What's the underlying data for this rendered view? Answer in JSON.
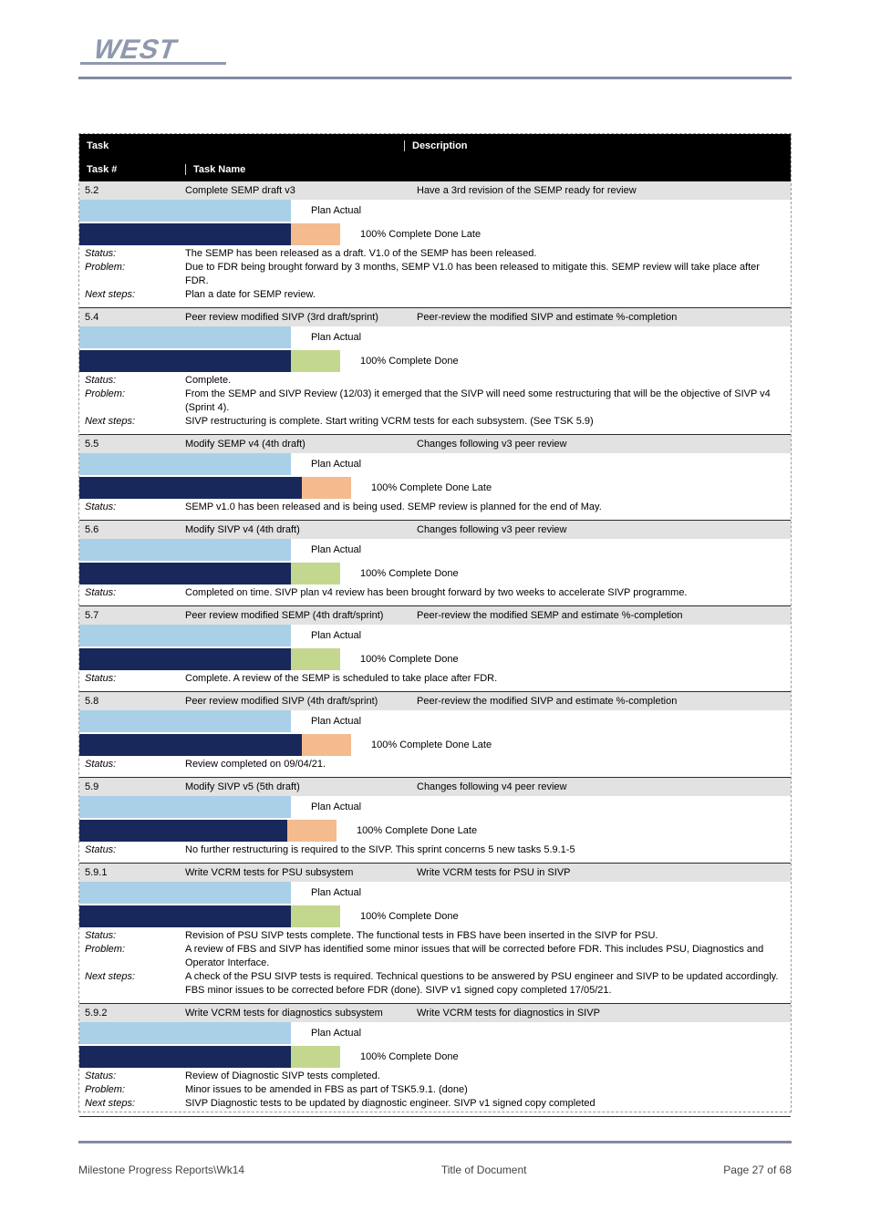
{
  "logo_text": "WEST",
  "footer": {
    "path": "Milestone Progress Reports\\Wk14",
    "title": "Title of Document",
    "page": "Page 27 of 68"
  },
  "thead": {
    "task": "Task",
    "description": "Description",
    "taskno": "Task #",
    "taskname": "Task Name"
  },
  "legend": {
    "plan": "Plan    Actual",
    "complete": "% Complete",
    "done": "Done",
    "late": "Late",
    "plan_label": "Plan",
    "actual_label": "Actual"
  },
  "section_labels": {
    "status": "Status:",
    "problem": "Problem:",
    "next": "Next steps:"
  },
  "rows": [
    {
      "num": "5.2",
      "name": "Complete SEMP draft v3",
      "desc": "Have a 3rd revision of the SEMP ready for review",
      "plan_w": 232,
      "act_w": 232,
      "btn": "peach",
      "plan_cap": "Plan    Actual",
      "done": "100% Complete  Done      Late",
      "status": "The SEMP has been released as a draft. V1.0 of the SEMP has been released.",
      "problem": "Due to FDR being brought forward by 3 months, SEMP V1.0 has been released to mitigate this. SEMP review will take place after FDR.",
      "next": "Plan a date for SEMP review."
    },
    {
      "num": "5.4",
      "name": "Peer review modified SIVP (3rd draft/sprint)",
      "desc": "Peer-review the modified SIVP and estimate %-completion",
      "plan_w": 232,
      "act_w": 232,
      "btn": "olive",
      "plan_cap": "Plan    Actual",
      "done": "100% Complete  Done",
      "status": "Complete.",
      "problem": "From the SEMP and SIVP Review (12/03) it emerged that the SIVP will need some restructuring that will be the objective of SIVP v4 (Sprint 4).",
      "next": "SIVP restructuring is complete. Start writing VCRM tests for each subsystem. (See TSK 5.9)"
    },
    {
      "num": "5.5",
      "name": "Modify SEMP   v4 (4th draft)",
      "desc": "Changes following v3 peer review",
      "plan_w": 232,
      "act_w": 244,
      "btn": "peach",
      "plan_cap": "Plan    Actual",
      "done": "100% Complete  Done      Late",
      "status": "SEMP v1.0 has been released and is being used. SEMP review is planned for the end of May.",
      "problem": "",
      "next": ""
    },
    {
      "num": "5.6",
      "name": "Modify SIVP    v4 (4th draft)",
      "desc": "Changes following v3 peer review",
      "plan_w": 232,
      "act_w": 232,
      "btn": "olive",
      "plan_cap": "Plan    Actual",
      "done": "100% Complete  Done",
      "status": "Completed on time. SIVP plan v4 review has been brought forward by two weeks to accelerate SIVP programme.",
      "problem": "",
      "next": ""
    },
    {
      "num": "5.7",
      "name": "Peer review modified SEMP (4th draft/sprint)",
      "desc": "Peer-review the modified SEMP and estimate %-completion",
      "plan_w": 232,
      "act_w": 232,
      "btn": "olive",
      "plan_cap": "Plan    Actual",
      "done": "100% Complete  Done",
      "status": "Complete.    A review of the SEMP is scheduled to take place after FDR.",
      "problem": "",
      "next": ""
    },
    {
      "num": "5.8",
      "name": "Peer review modified SIVP (4th draft/sprint)",
      "desc": "Peer-review the modified SIVP and estimate %-completion",
      "plan_w": 232,
      "act_w": 244,
      "btn": "peach",
      "plan_cap": "Plan    Actual",
      "done": "100% Complete  Done      Late",
      "status": "Review completed on 09/04/21.",
      "problem": "",
      "next": ""
    },
    {
      "num": "5.9",
      "name": "Modify SIVP    v5 (5th draft)",
      "desc": "Changes following v4 peer review",
      "plan_w": 232,
      "act_w": 228,
      "btn": "peach",
      "plan_cap": "Plan    Actual",
      "done": "100% Complete  Done      Late",
      "status": "No further restructuring is required to the SIVP. This sprint concerns 5 new tasks 5.9.1-5",
      "problem": "",
      "next": ""
    },
    {
      "num": "5.9.1",
      "name": "Write VCRM tests for PSU subsystem",
      "desc": "Write VCRM tests for PSU in SIVP",
      "plan_w": 232,
      "act_w": 232,
      "btn": "olive",
      "plan_cap": "Plan    Actual",
      "done": "100% Complete  Done",
      "status": "Revision of PSU SIVP tests complete. The functional tests in FBS have been inserted in the SIVP for PSU.",
      "problem": "A review of FBS and SIVP has identified some minor issues that will be corrected before FDR. This includes PSU, Diagnostics and Operator Interface.",
      "next": "A check of the PSU SIVP tests is required. Technical questions to be answered by PSU engineer and SIVP to be updated accordingly.  FBS minor issues to be corrected before FDR (done). SIVP v1 signed copy completed 17/05/21."
    },
    {
      "num": "5.9.2",
      "name": "Write VCRM tests for diagnostics subsystem",
      "desc": "Write VCRM tests for diagnostics in SIVP",
      "plan_w": 232,
      "act_w": 232,
      "btn": "olive",
      "plan_cap": "Plan    Actual",
      "done": "100% Complete  Done",
      "status": "Review of Diagnostic SIVP tests completed.",
      "problem": "Minor issues to be amended in FBS as part of TSK5.9.1. (done)",
      "next": "SIVP Diagnostic tests to be updated by diagnostic engineer. SIVP v1 signed copy completed"
    }
  ]
}
